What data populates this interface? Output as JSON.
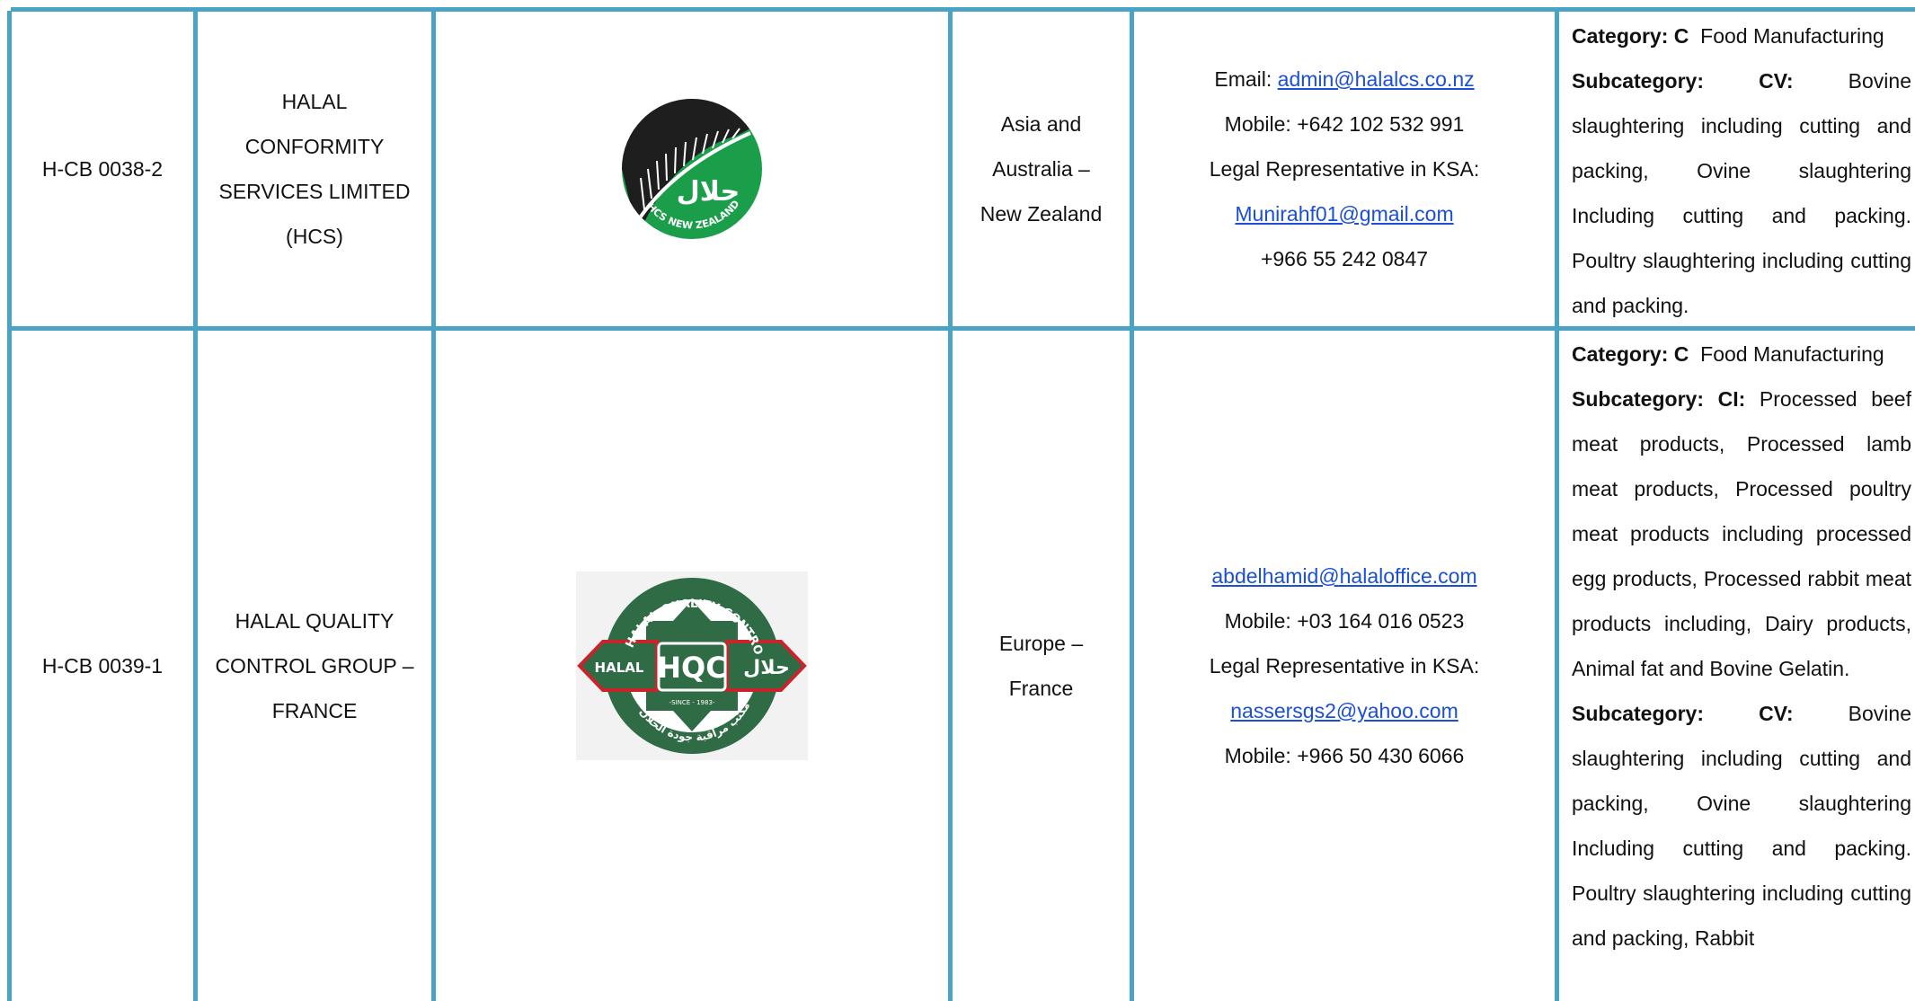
{
  "table": {
    "rows": [
      {
        "code": "H-CB 0038-2",
        "name_lines": [
          "HALAL",
          "CONFORMITY",
          "SERVICES LIMITED",
          "(HCS)"
        ],
        "logo": {
          "name": "hcs-new-zealand-logo",
          "arabic_text": "حلال",
          "ring_text": "HCS NEW ZEALAND",
          "colors": {
            "green": "#1a9e4a",
            "black": "#1e1e1e",
            "white": "#ffffff"
          }
        },
        "region_lines": [
          "Asia and",
          "Australia –",
          "New  Zealand"
        ],
        "contact": {
          "email_label": "Email:",
          "email": "admin@halalcs.co.nz",
          "mobile": "Mobile: +642 102 532 991",
          "legal_rep": "Legal Representative in KSA:",
          "rep_email": "Munirahf01@gmail.com",
          "rep_phone": "+966 55 242 0847"
        },
        "description": {
          "category_label": "Category: C",
          "category_text": "Food Manufacturing",
          "sub1_label": "Subcategory:",
          "sub1_code": "CV:",
          "sub1_text": "Bovine slaughtering including cutting and packing, Ovine slaughtering Including cutting and packing. Poultry slaughtering including cutting and packing."
        }
      },
      {
        "code": "H-CB 0039-1",
        "name_lines": [
          "HALAL QUALITY",
          "CONTROL GROUP –",
          "FRANCE"
        ],
        "logo": {
          "name": "hqc-halal-quality-control-logo",
          "main_text": "HQC",
          "left_text": "HALAL",
          "right_text": "حلال",
          "ring_text": "HALAL QUALITY CONTROL",
          "since": "-SINCE - 1983-",
          "arabic_bottom": "مكتب مراقبة جودة الحلال",
          "colors": {
            "green": "#2f6b45",
            "red": "#c7252b",
            "white": "#ffffff",
            "bg": "#f2f2f2"
          }
        },
        "region_lines": [
          "Europe –",
          "France"
        ],
        "contact": {
          "email": "abdelhamid@halaloffice.com",
          "mobile": "Mobile: +03 164 016 0523",
          "legal_rep": "Legal Representative in KSA:",
          "rep_email": "nassersgs2@yahoo.com",
          "rep_phone": "Mobile: +966 50 430 6066"
        },
        "description": {
          "category_label": "Category: C",
          "category_text": "Food Manufacturing",
          "sub1_label": "Subcategory: CI:",
          "sub1_text": "Processed beef meat products, Processed lamb meat products, Processed poultry meat products including processed egg products, Processed rabbit meat products including, Dairy products, Animal fat and Bovine Gelatin.",
          "sub2_label": "Subcategory:",
          "sub2_code": "CV:",
          "sub2_text": "Bovine slaughtering including cutting and packing, Ovine slaughtering Including cutting and packing. Poultry slaughtering including cutting and packing, Rabbit"
        }
      }
    ]
  },
  "colors": {
    "border": "#4aa3c5",
    "link": "#1a4fd6",
    "text": "#111111"
  }
}
